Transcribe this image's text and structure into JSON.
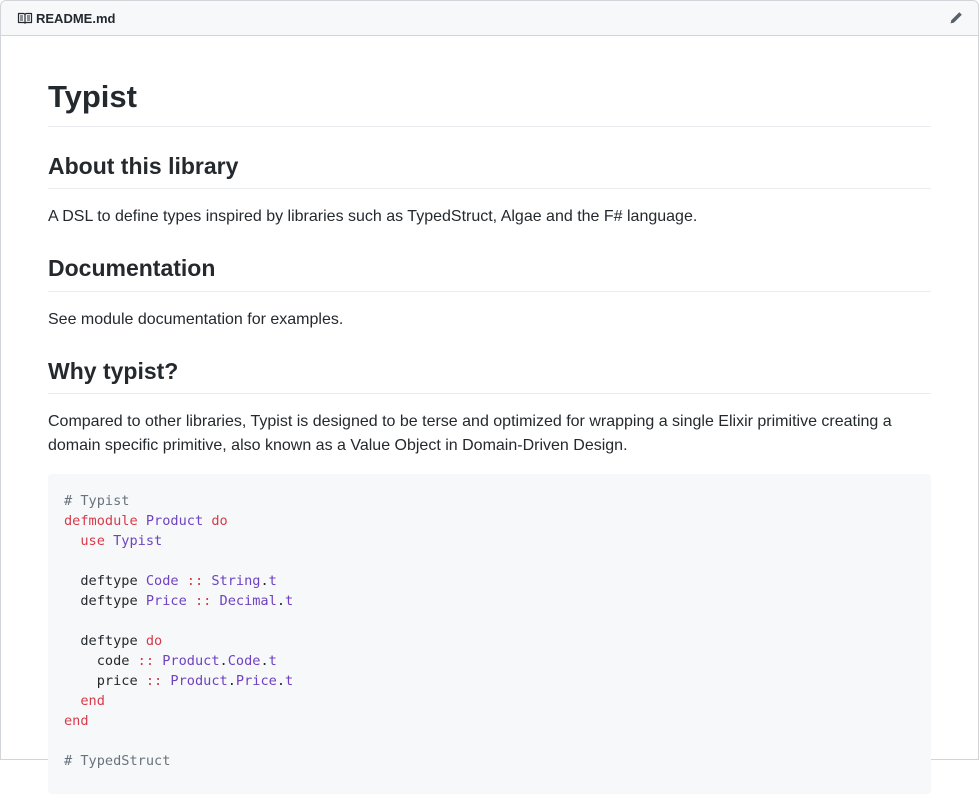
{
  "file_header": {
    "filename": "README.md",
    "icons": {
      "file": "book-icon",
      "edit": "pencil-icon"
    }
  },
  "readme": {
    "title": "Typist",
    "sections": [
      {
        "heading": "About this library",
        "body": "A DSL to define types inspired by libraries such as TypedStruct, Algae and the F# language."
      },
      {
        "heading": "Documentation",
        "body": "See module documentation for examples."
      },
      {
        "heading": "Why typist?",
        "body": "Compared to other libraries, Typist is designed to be terse and optimized for wrapping a single Elixir primitive creating a domain specific primitive, also known as a Value Object in Domain-Driven Design."
      }
    ],
    "code_lines": [
      [
        {
          "c": "c",
          "s": "# Typist"
        }
      ],
      [
        {
          "c": "k",
          "s": "defmodule"
        },
        {
          "c": "p",
          "s": " "
        },
        {
          "c": "t",
          "s": "Product"
        },
        {
          "c": "p",
          "s": " "
        },
        {
          "c": "k",
          "s": "do"
        }
      ],
      [
        {
          "c": "p",
          "s": "  "
        },
        {
          "c": "k",
          "s": "use"
        },
        {
          "c": "p",
          "s": " "
        },
        {
          "c": "t",
          "s": "Typist"
        }
      ],
      [],
      [
        {
          "c": "p",
          "s": "  deftype "
        },
        {
          "c": "t",
          "s": "Code"
        },
        {
          "c": "p",
          "s": " "
        },
        {
          "c": "k",
          "s": "::"
        },
        {
          "c": "p",
          "s": " "
        },
        {
          "c": "t",
          "s": "String"
        },
        {
          "c": "p",
          "s": "."
        },
        {
          "c": "t",
          "s": "t"
        }
      ],
      [
        {
          "c": "p",
          "s": "  deftype "
        },
        {
          "c": "t",
          "s": "Price"
        },
        {
          "c": "p",
          "s": " "
        },
        {
          "c": "k",
          "s": "::"
        },
        {
          "c": "p",
          "s": " "
        },
        {
          "c": "t",
          "s": "Decimal"
        },
        {
          "c": "p",
          "s": "."
        },
        {
          "c": "t",
          "s": "t"
        }
      ],
      [],
      [
        {
          "c": "p",
          "s": "  deftype "
        },
        {
          "c": "k",
          "s": "do"
        }
      ],
      [
        {
          "c": "p",
          "s": "    code "
        },
        {
          "c": "k",
          "s": "::"
        },
        {
          "c": "p",
          "s": " "
        },
        {
          "c": "t",
          "s": "Product"
        },
        {
          "c": "p",
          "s": "."
        },
        {
          "c": "t",
          "s": "Code"
        },
        {
          "c": "p",
          "s": "."
        },
        {
          "c": "t",
          "s": "t"
        }
      ],
      [
        {
          "c": "p",
          "s": "    price "
        },
        {
          "c": "k",
          "s": "::"
        },
        {
          "c": "p",
          "s": " "
        },
        {
          "c": "t",
          "s": "Product"
        },
        {
          "c": "p",
          "s": "."
        },
        {
          "c": "t",
          "s": "Price"
        },
        {
          "c": "p",
          "s": "."
        },
        {
          "c": "t",
          "s": "t"
        }
      ],
      [
        {
          "c": "p",
          "s": "  "
        },
        {
          "c": "k",
          "s": "end"
        }
      ],
      [
        {
          "c": "k",
          "s": "end"
        }
      ],
      [],
      [
        {
          "c": "c",
          "s": "# TypedStruct"
        }
      ]
    ]
  },
  "colors": {
    "text": "#24292e",
    "comment": "#6a737d",
    "keyword": "#d73a49",
    "type": "#6f42c1",
    "code_bg": "#f6f8fa",
    "border": "#eaecef"
  }
}
